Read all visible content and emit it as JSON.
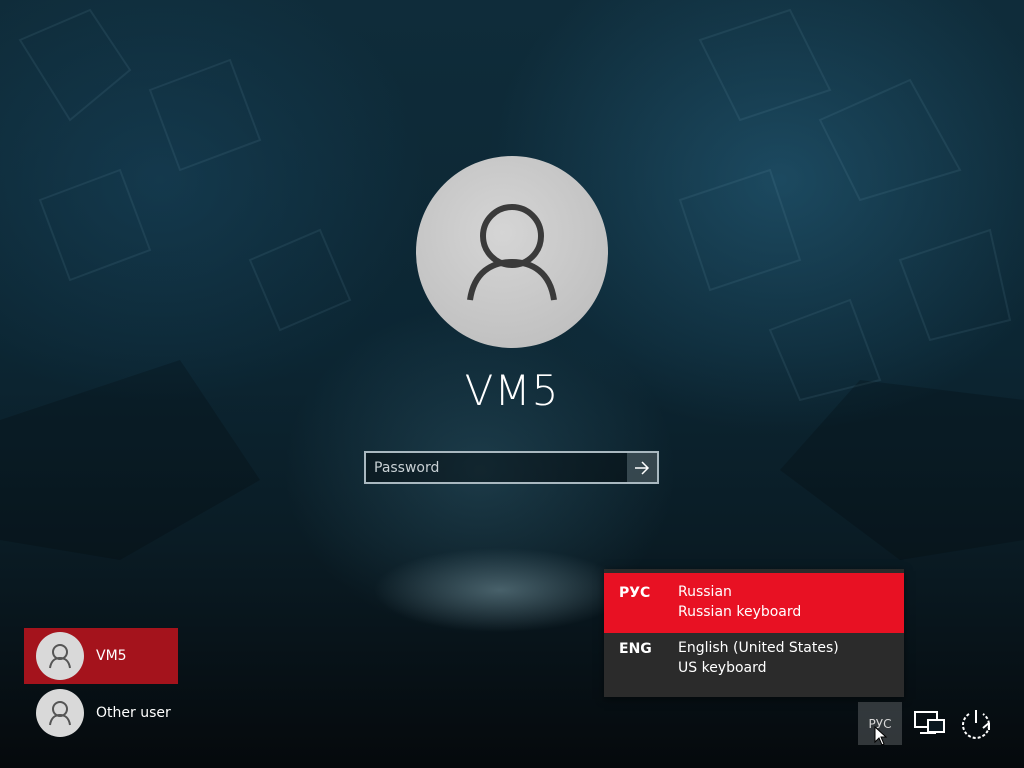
{
  "login": {
    "user_name": "VM5",
    "password_placeholder": "Password"
  },
  "user_list": [
    {
      "name": "VM5",
      "selected": true
    },
    {
      "name": "Other user",
      "selected": false
    }
  ],
  "language_menu": {
    "items": [
      {
        "code": "РУС",
        "language": "Russian",
        "keyboard": "Russian keyboard",
        "active": true
      },
      {
        "code": "ENG",
        "language": "English (United States)",
        "keyboard": "US keyboard",
        "active": false
      }
    ]
  },
  "tray": {
    "language_indicator": "РУС",
    "icons": [
      "network-icon",
      "power-icon"
    ]
  },
  "colors": {
    "selected_tile": "#a4131c",
    "active_language": "#e81123",
    "menu_background": "#2b2b2b"
  }
}
